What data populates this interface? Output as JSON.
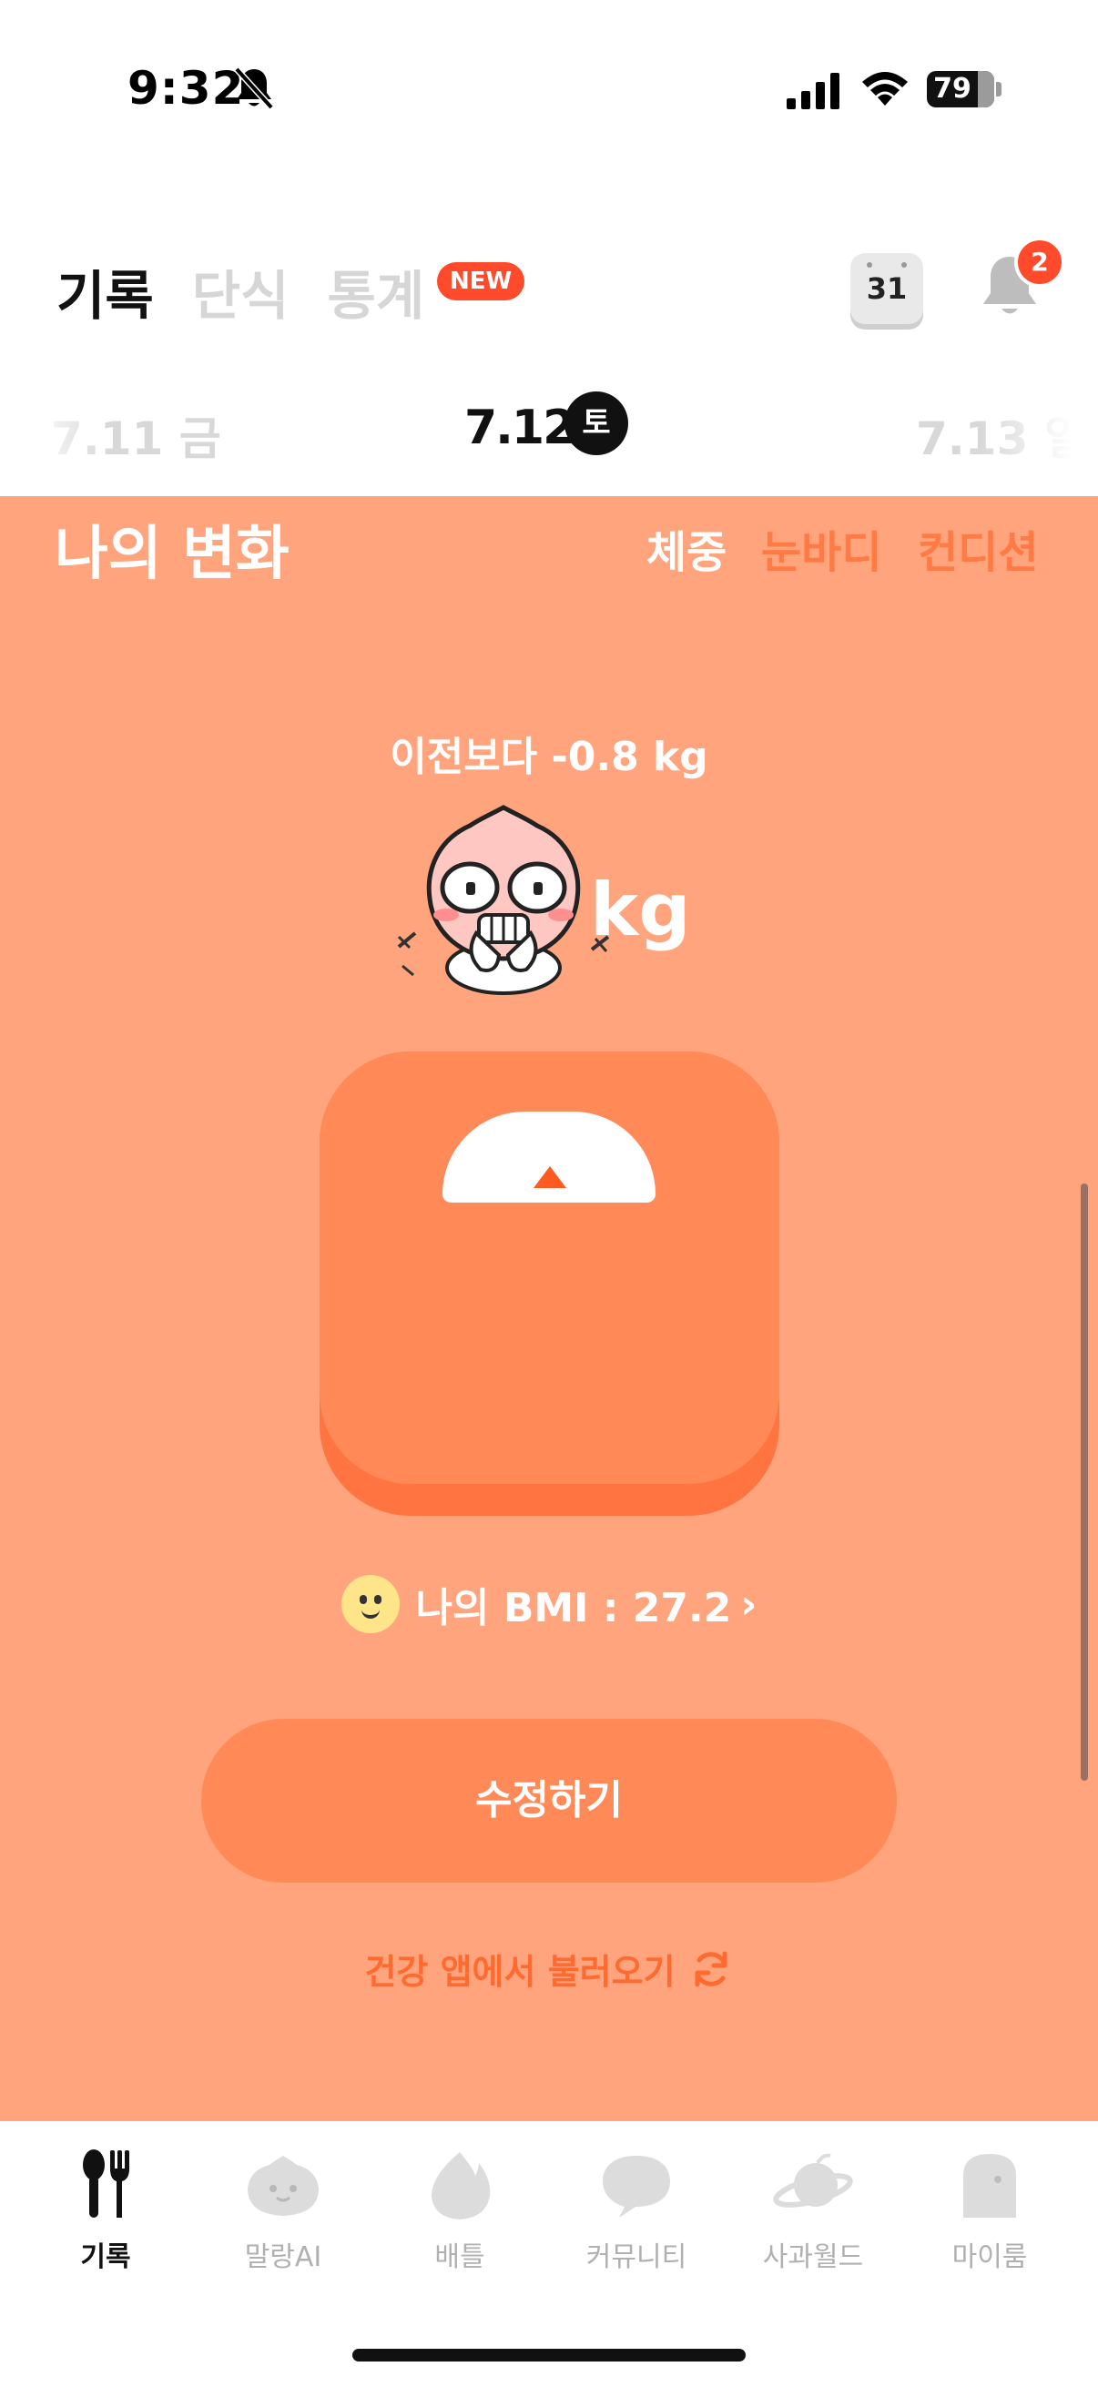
{
  "status_bar": {
    "time": "9:32",
    "battery": "79"
  },
  "header": {
    "tabs": [
      {
        "label": "기록",
        "active": true
      },
      {
        "label": "단식",
        "active": false
      },
      {
        "label": "통계",
        "active": false
      }
    ],
    "new_badge": "NEW",
    "calendar_day": "31",
    "notification_count": "2"
  },
  "date_strip": {
    "prev": "7.11 금",
    "current": "7.12",
    "current_day": "토",
    "next": "7.13 일"
  },
  "section": {
    "title": "나의 변화",
    "segments": [
      {
        "label": "체중",
        "active": true
      },
      {
        "label": "눈바디",
        "active": false
      },
      {
        "label": "컨디션",
        "active": false
      }
    ],
    "delta": "이전보다 -0.8 kg",
    "weight_unit": "kg",
    "bmi": "나의 BMI : 27.2",
    "edit_button": "수정하기",
    "import_text": "건강 앱에서 불러오기"
  },
  "colors": {
    "accent": "#ff8a58",
    "background": "#ffa47c",
    "alert": "#ff4b2b"
  },
  "bottom_nav": [
    {
      "label": "기록",
      "icon": "fork-knife-icon",
      "active": true
    },
    {
      "label": "말랑AI",
      "icon": "blob-character-icon",
      "active": false
    },
    {
      "label": "배틀",
      "icon": "flame-icon",
      "active": false
    },
    {
      "label": "커뮤니티",
      "icon": "chat-bubble-icon",
      "active": false
    },
    {
      "label": "사과월드",
      "icon": "planet-icon",
      "active": false
    },
    {
      "label": "마이룸",
      "icon": "ghost-room-icon",
      "active": false
    }
  ]
}
